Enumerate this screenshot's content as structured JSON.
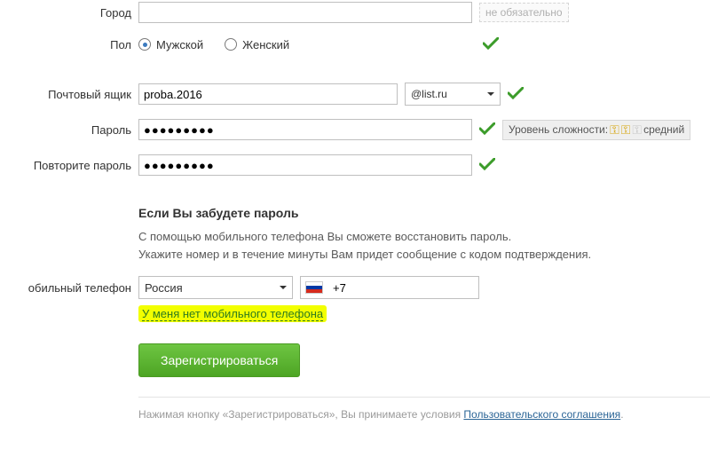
{
  "labels": {
    "city": "Город",
    "gender": "Пол",
    "mailbox": "Почтовый ящик",
    "password": "Пароль",
    "password_repeat": "Повторите пароль",
    "mobile": "обильный телефон"
  },
  "hints": {
    "optional": "не обязательно"
  },
  "gender": {
    "male": "Мужской",
    "female": "Женский"
  },
  "mailbox": {
    "value": "proba.2016",
    "domain": "@list.ru"
  },
  "password": {
    "value": "●●●●●●●●●",
    "repeat_value": "●●●●●●●●●"
  },
  "strength": {
    "label": "Уровень сложности:",
    "level": "средний"
  },
  "recovery": {
    "title": "Если Вы забудете пароль",
    "text1": "С помощью мобильного телефона Вы сможете восстановить пароль.",
    "text2": "Укажите номер и в течение минуты Вам придет сообщение с кодом подтверждения."
  },
  "phone": {
    "country": "Россия",
    "prefix": "+7"
  },
  "no_phone_link": "У меня нет мобильного телефона",
  "register_btn": "Зарегистрироваться",
  "tos": {
    "pre": "Нажимая кнопку «Зарегистрироваться», Вы принимаете условия ",
    "link": "Пользовательского соглашения",
    "post": "."
  }
}
